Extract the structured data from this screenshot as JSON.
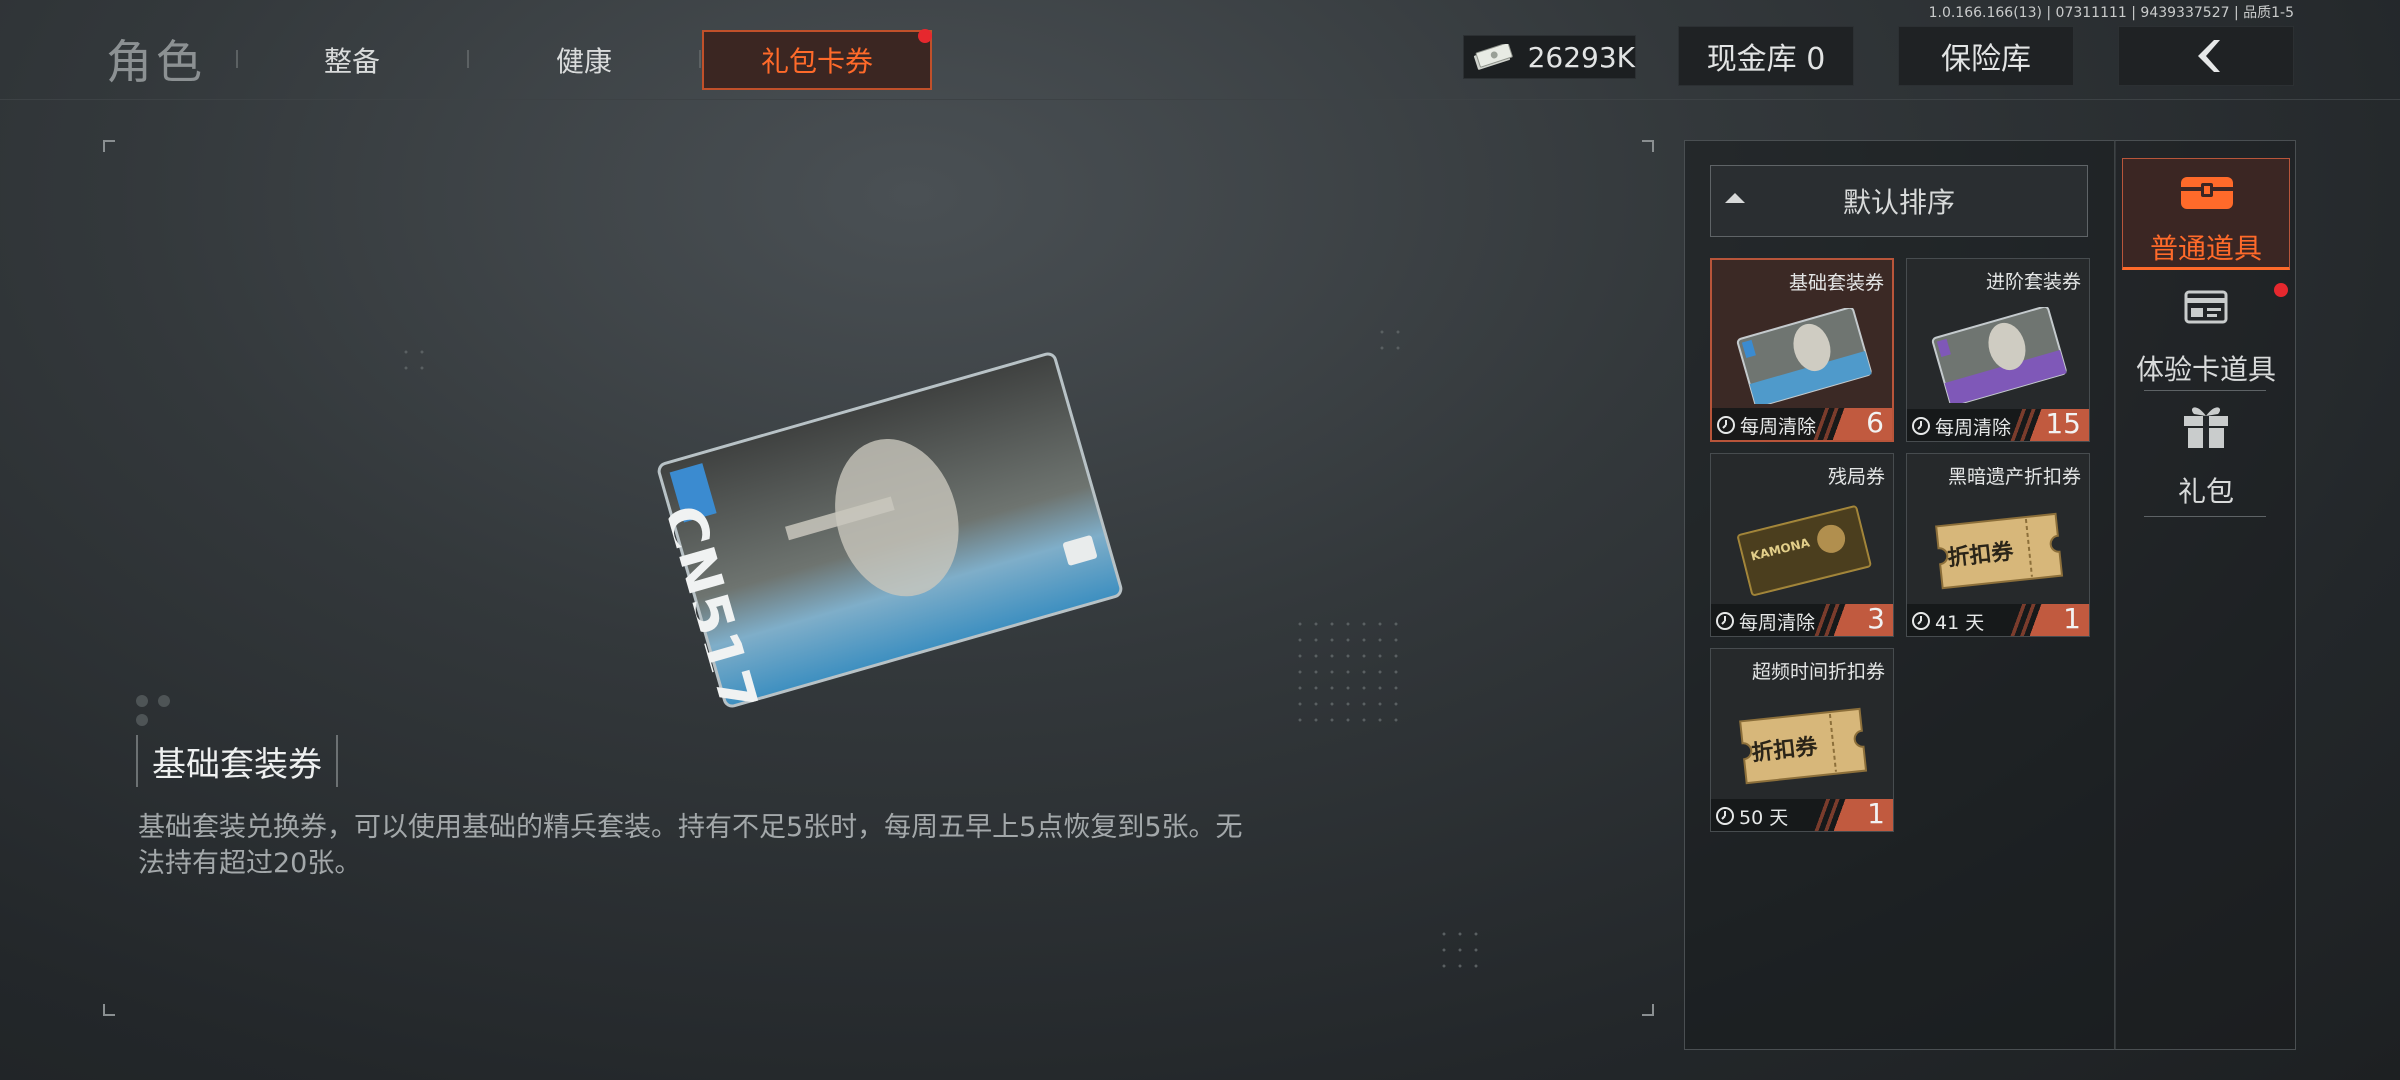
{
  "version_text": "1.0.166.166(13) | 07311111 | 9439337527 | 品质1-5",
  "nav": {
    "title": "角色",
    "tabs": [
      "整备",
      "健康"
    ],
    "active_tab": "礼包卡券"
  },
  "currency": {
    "icon": "cash-icon",
    "value": "26293K"
  },
  "buttons": {
    "cash_vault": "现金库 0",
    "safe_box": "保险库",
    "back_icon": "chevron-left-icon"
  },
  "selected_item": {
    "name": "基础套装券",
    "description": "基础套装兑换券，可以使用基础的精兵套装。持有不足5张时，每周五早上5点恢复到5张。无法持有超过20张。",
    "card_text": "CN517"
  },
  "inventory": {
    "sort_label": "默认排序",
    "items": [
      {
        "name": "基础套装券",
        "expiry": "每周清除",
        "count": "6",
        "art": "suit-card",
        "selected": true
      },
      {
        "name": "进阶套装券",
        "expiry": "每周清除",
        "count": "15",
        "art": "suit-card-purple",
        "selected": false
      },
      {
        "name": "残局券",
        "expiry": "每周清除",
        "count": "3",
        "art": "kamona-card",
        "selected": false,
        "art_text": "KAMONA"
      },
      {
        "name": "黑暗遗产折扣券",
        "expiry": "41 天",
        "count": "1",
        "art": "discount-ticket",
        "selected": false,
        "art_text": "折扣券"
      },
      {
        "name": "超频时间折扣券",
        "expiry": "50 天",
        "count": "1",
        "art": "discount-ticket",
        "selected": false,
        "art_text": "折扣券"
      }
    ]
  },
  "categories": [
    {
      "label": "普通道具",
      "icon": "chest-icon",
      "active": true
    },
    {
      "label": "体验卡道具",
      "icon": "trial-card-icon",
      "active": false,
      "badge": true
    },
    {
      "label": "礼包",
      "icon": "gift-icon",
      "active": false
    }
  ],
  "colors": {
    "accent": "#ff6a2a",
    "selected_bg": "#3b2925",
    "badge": "#e6282e"
  }
}
